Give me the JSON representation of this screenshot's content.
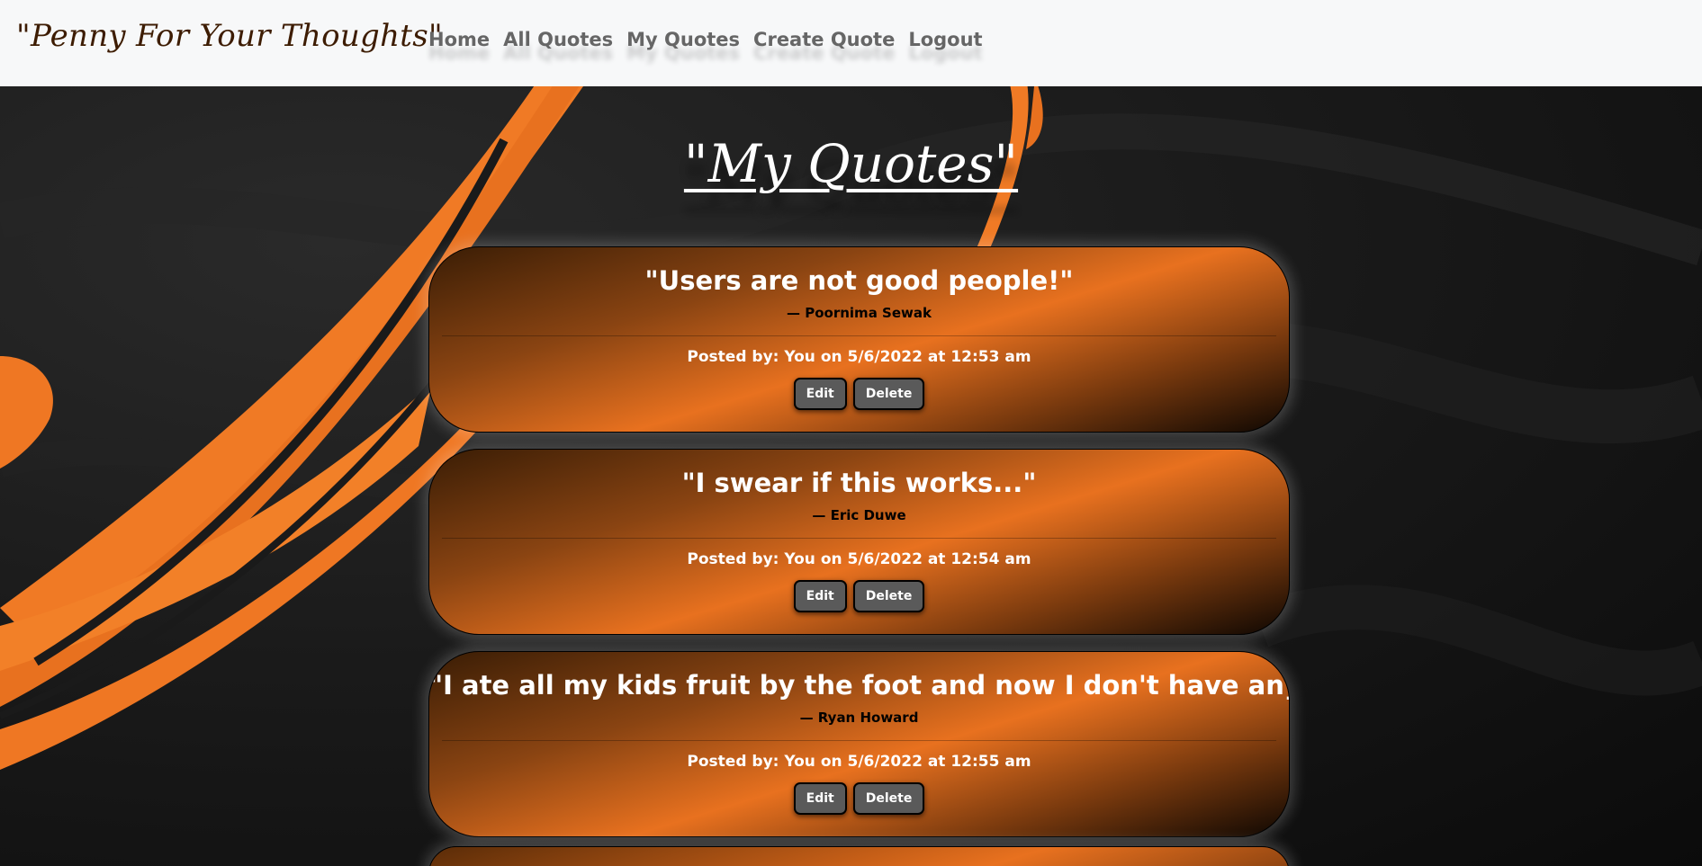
{
  "brand": {
    "name": "\"Penny For Your Thoughts\""
  },
  "nav": {
    "links": [
      {
        "label": "Home"
      },
      {
        "label": "All Quotes"
      },
      {
        "label": "My Quotes"
      },
      {
        "label": "Create Quote"
      },
      {
        "label": "Logout"
      }
    ]
  },
  "page": {
    "title": "\"My Quotes\""
  },
  "quotes": [
    {
      "text": "\"Users are not good people!\"",
      "author": "— Poornima Sewak",
      "posted": "Posted by: You on 5/6/2022 at 12:53 am",
      "edit_label": "Edit",
      "delete_label": "Delete"
    },
    {
      "text": "\"I swear if this works...\"",
      "author": "— Eric Duwe",
      "posted": "Posted by: You on 5/6/2022 at 12:54 am",
      "edit_label": "Edit",
      "delete_label": "Delete"
    },
    {
      "text": "\"I ate all my kids fruit by the foot and now I don't have anymore.\"",
      "author": "— Ryan Howard",
      "posted": "Posted by: You on 5/6/2022 at 12:55 am",
      "edit_label": "Edit",
      "delete_label": "Delete"
    }
  ],
  "colors": {
    "brand_text": "#3d1c02",
    "nav_text": "#666666",
    "accent_orange": "#e8711f",
    "button_bg": "#5a5a5a"
  }
}
